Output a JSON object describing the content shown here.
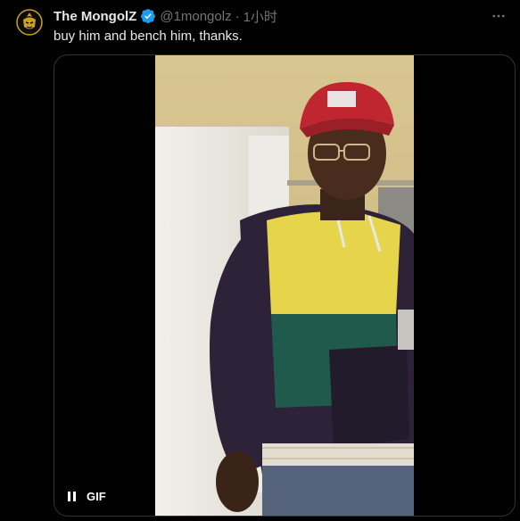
{
  "tweet": {
    "author": {
      "name": "The MongolZ",
      "handle": "@1mongolz",
      "separator": "·",
      "time": "1小时"
    },
    "text": "buy him and bench him, thanks.",
    "media": {
      "badge": "GIF",
      "control_icon": "pause-icon"
    }
  },
  "icons": {
    "verified": "verified-badge-icon",
    "more": "more-icon",
    "avatar": "team-logo"
  },
  "colors": {
    "background": "#000000",
    "primary_text": "#e7e9ea",
    "secondary_text": "#71767b",
    "verified": "#1d9bf0",
    "border": "#2f3336"
  }
}
